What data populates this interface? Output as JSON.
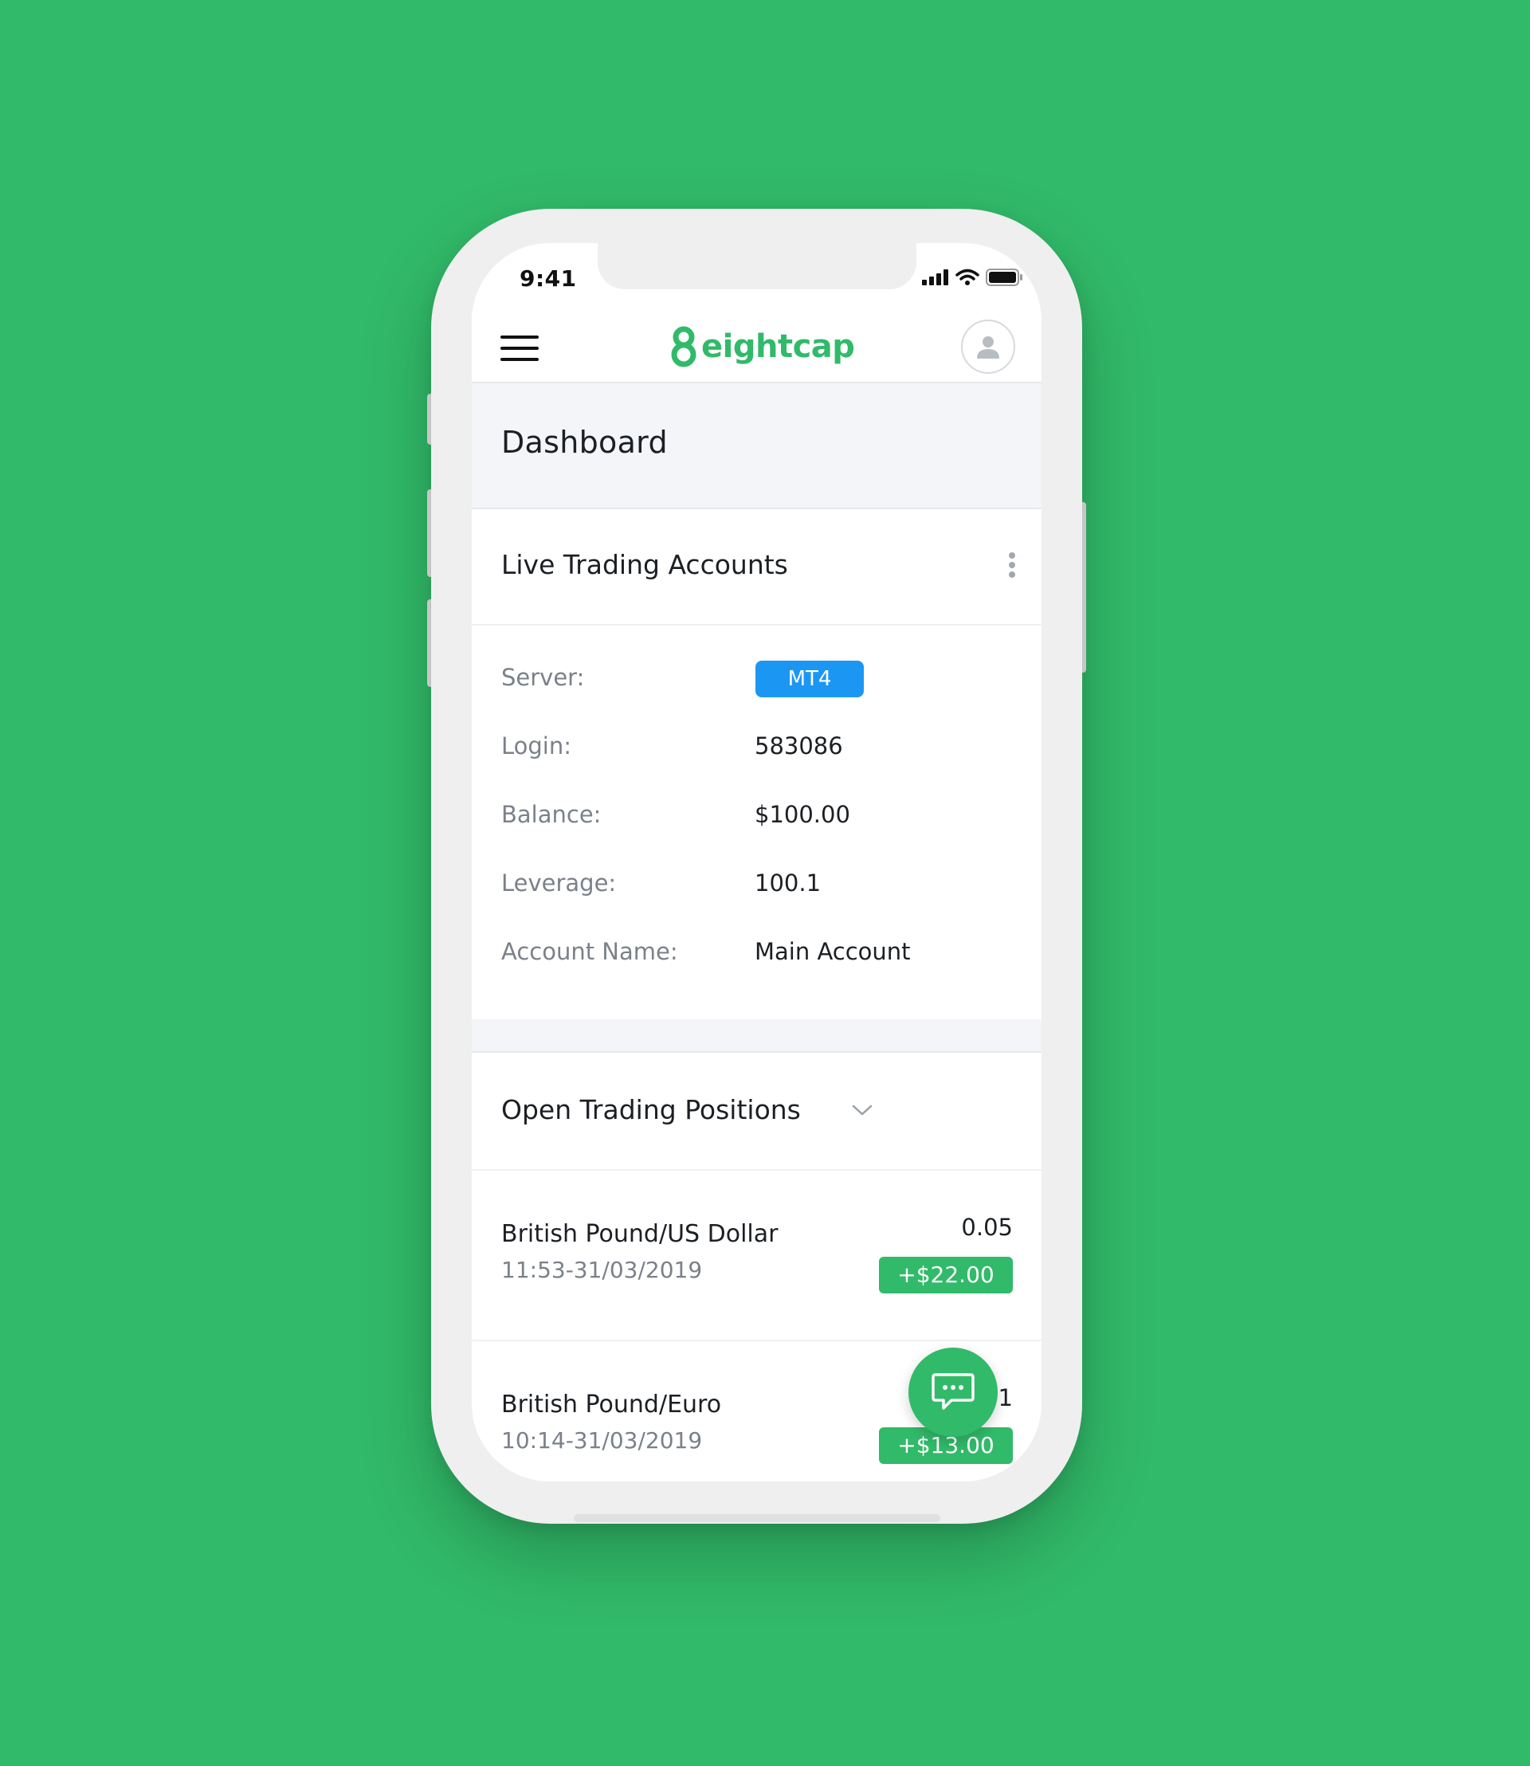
{
  "status_bar": {
    "time": "9:41"
  },
  "header": {
    "logo_text": "eightcap",
    "menu_icon": "hamburger-icon",
    "profile_icon": "user-icon",
    "brand_color": "#31ba69"
  },
  "page": {
    "title": "Dashboard"
  },
  "live_accounts": {
    "title": "Live Trading Accounts",
    "menu_icon": "more-vertical-icon",
    "rows": [
      {
        "label": "Server:",
        "value": "MT4"
      },
      {
        "label": "Login:",
        "value": "583086"
      },
      {
        "label": "Balance:",
        "value": "$100.00"
      },
      {
        "label": "Leverage:",
        "value": "100.1"
      },
      {
        "label": "Account Name:",
        "value": "Main Account"
      }
    ],
    "server_badge_color": "#1b97f3"
  },
  "open_positions": {
    "title": "Open Trading Positions",
    "toggle_icon": "chevron-down-icon",
    "items": [
      {
        "name": "British Pound/US Dollar",
        "time": "11:53-31/03/2019",
        "qty": "0.05",
        "pl": "+$22.00"
      },
      {
        "name": "British Pound/Euro",
        "time": "10:14-31/03/2019",
        "qty": "0.1",
        "pl": "+$13.00"
      }
    ]
  },
  "chat": {
    "icon": "chat-bubble-icon"
  },
  "colors": {
    "background": "#31ba69",
    "profit": "#31ba69"
  }
}
